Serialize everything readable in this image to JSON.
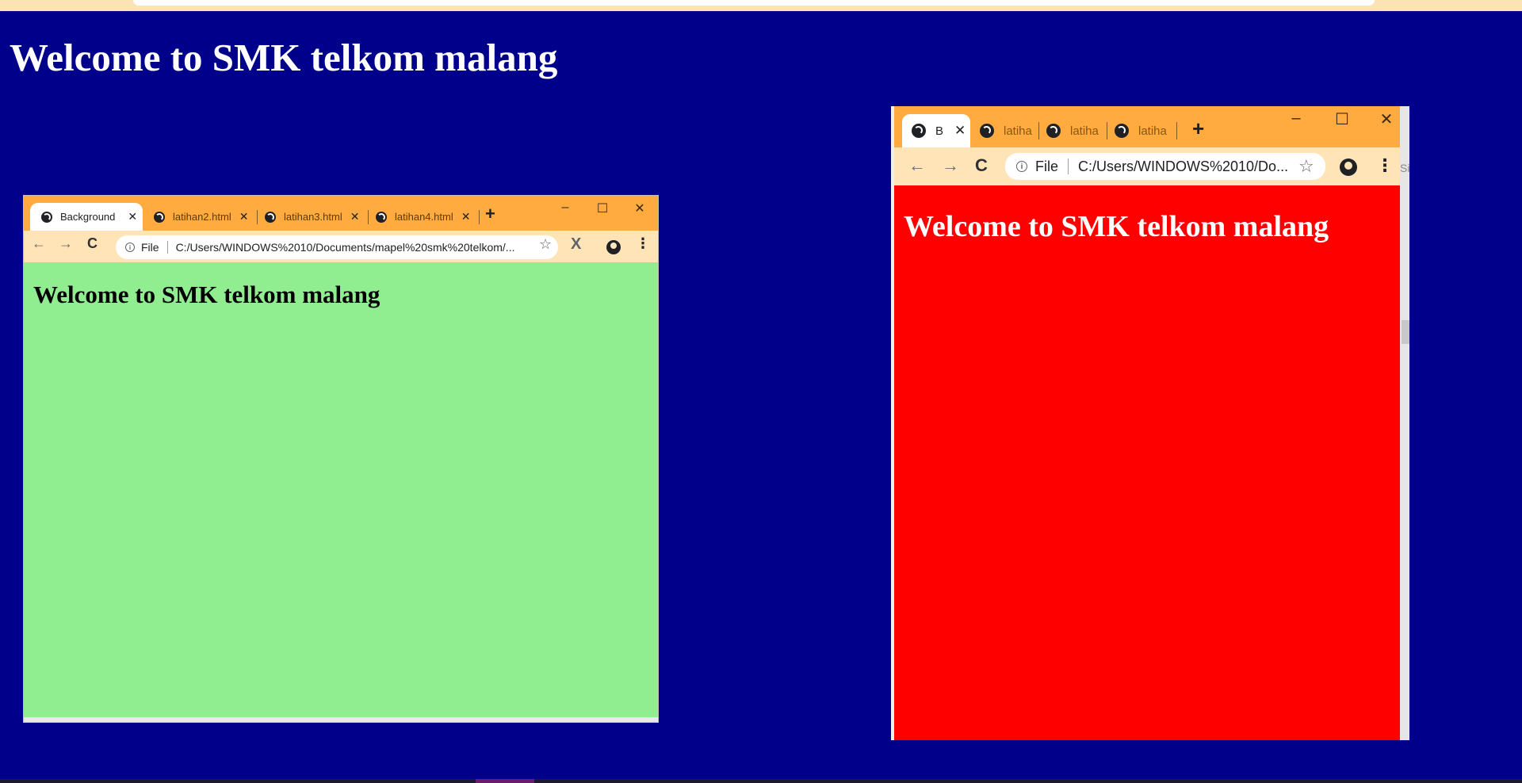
{
  "page": {
    "heading": "Welcome to SMK telkom malang",
    "background_color": "#00008b"
  },
  "window_green": {
    "tabs": [
      {
        "label": "Background",
        "active": true
      },
      {
        "label": "latihan2.html",
        "active": false
      },
      {
        "label": "latihan3.html",
        "active": false
      },
      {
        "label": "latihan4.html",
        "active": false
      }
    ],
    "new_tab_glyph": "+",
    "controls": {
      "minimize": "–",
      "maximize": "☐",
      "close": "✕"
    },
    "nav": {
      "back": "←",
      "forward": "→",
      "reload": "C"
    },
    "omnibox": {
      "info": "i",
      "scheme_label": "File",
      "url": "C:/Users/WINDOWS%2010/Documents/mapel%20smk%20telkom/..."
    },
    "star": "☆",
    "extension": "X",
    "menu": "⋮",
    "content_heading": "Welcome to SMK telkom malang",
    "content_background": "#90ee90",
    "tabstrip_color": "#ffab40"
  },
  "window_red": {
    "tabs": [
      {
        "label": "B",
        "active": true
      },
      {
        "label": "latiha",
        "active": false
      },
      {
        "label": "latiha",
        "active": false
      },
      {
        "label": "latiha",
        "active": false
      }
    ],
    "new_tab_glyph": "+",
    "controls": {
      "minimize": "–",
      "maximize": "☐",
      "close": "✕"
    },
    "nav": {
      "back": "←",
      "forward": "→",
      "reload": "C"
    },
    "omnibox": {
      "info": "i",
      "scheme_label": "File",
      "url": "C:/Users/WINDOWS%2010/Do..."
    },
    "star": "☆",
    "menu": "⋮",
    "content_heading": "Welcome to SMK telkom malang",
    "content_background": "#ff0000",
    "edge_peek_text": "Si"
  }
}
